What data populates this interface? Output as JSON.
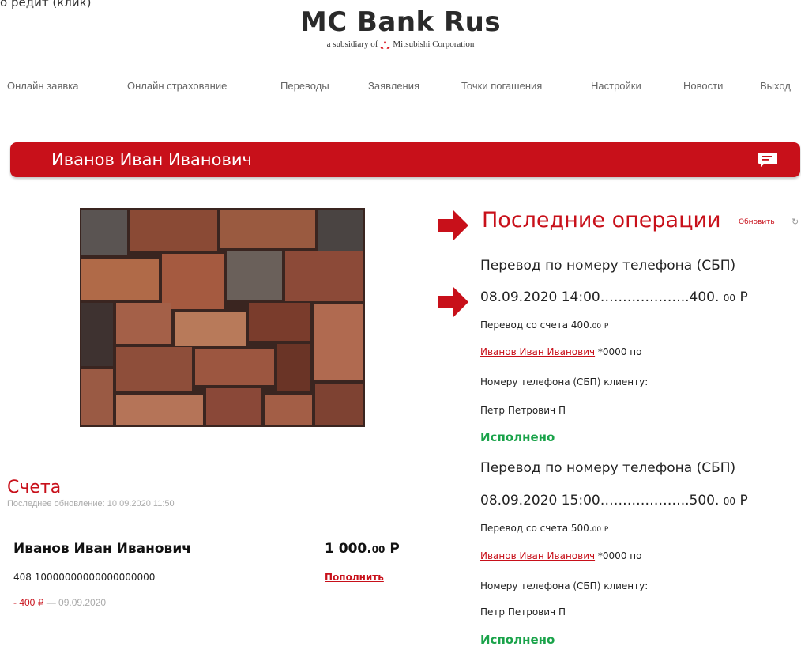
{
  "page_fragment": "о редит (клик)",
  "brand": {
    "name": "MC Bank Rus",
    "subtitle_pre": "a subsidiary of",
    "subtitle_corp": "Mitsubishi Corporation"
  },
  "nav": {
    "items": [
      {
        "label": "Онлайн заявка"
      },
      {
        "label": "Онлайн страхование"
      },
      {
        "label": "Переводы"
      },
      {
        "label": "Заявления"
      },
      {
        "label": "Точки погашения"
      },
      {
        "label": "Настройки"
      },
      {
        "label": "Новости"
      },
      {
        "label": "Выход"
      }
    ]
  },
  "user": {
    "full_name": "Иванов Иван Иванович"
  },
  "accounts": {
    "title": "Счета",
    "updated": "Последнее обновление: 10.09.2020 11:50",
    "item": {
      "owner": "Иванов Иван Иванович",
      "amount_main": "1 000.",
      "amount_cents": "00",
      "currency": "Р",
      "number": "408 10000000000000000000",
      "topup_label": "Пополнить",
      "last_amount": "- 400",
      "last_currency": "₽",
      "last_rest": "— 09.09.2020"
    }
  },
  "operations": {
    "title": "Последние операции",
    "refresh_label": "Обновить",
    "items": [
      {
        "title": "Перевод по номеру телефона (СБП)",
        "datetime": "08.09.2020 14:00………………..400.",
        "amount_cents": "00",
        "currency": "Р",
        "from_label": "Перевод со счета  400.",
        "from_cents": "00",
        "from_currency": "Р",
        "payer": "Иванов Иван Иванович",
        "payer_rest": " *0000 по",
        "line3": "Номеру телефона  (СБП) клиенту:",
        "recipient": "Петр Петрович П",
        "status": "Исполнено"
      },
      {
        "title": "Перевод по номеру телефона (СБП)",
        "datetime": "08.09.2020 15:00………………..500.",
        "amount_cents": "00",
        "currency": "Р",
        "from_label": "Перевод со счета  500.",
        "from_cents": "00",
        "from_currency": "Р",
        "payer": "Иванов Иван Иванович",
        "payer_rest": " *0000 по",
        "line3": "Номеру телефона  (СБП) клиенту:",
        "recipient": "Петр Петрович П",
        "status": "Исполнено"
      }
    ]
  },
  "colors": {
    "brand_red": "#c8101a",
    "status_green": "#1aa34a"
  },
  "icons": {
    "message": "message-icon",
    "refresh": "refresh-icon",
    "arrow": "red-arrow-icon"
  }
}
